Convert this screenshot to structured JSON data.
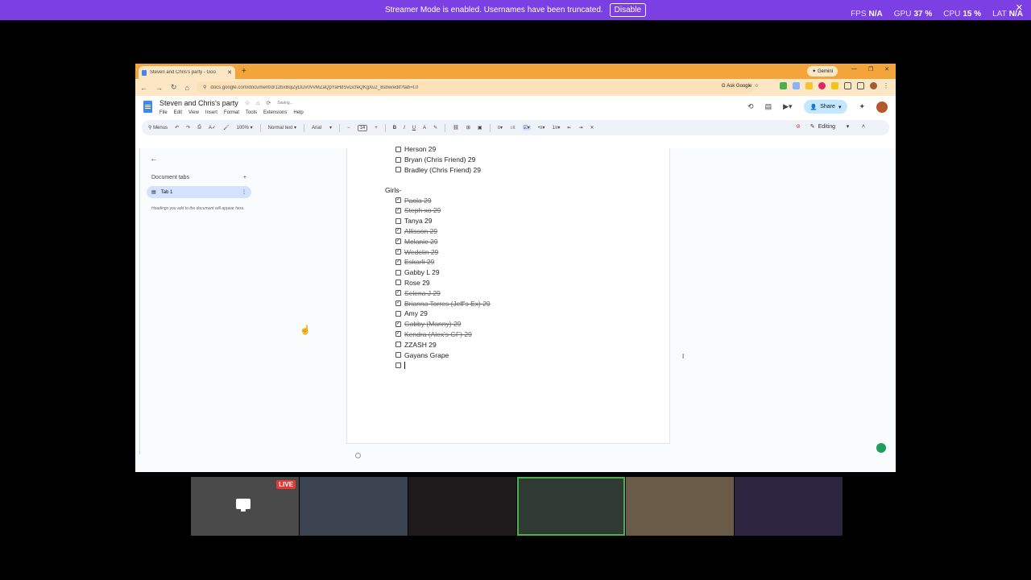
{
  "streamer": {
    "message": "Streamer Mode is enabled. Usernames have been truncated.",
    "disable_label": "Disable",
    "stats": [
      {
        "label": "FPS",
        "value": "N/A"
      },
      {
        "label": "GPU",
        "value": "37 %"
      },
      {
        "label": "CPU",
        "value": "15 %"
      },
      {
        "label": "LAT",
        "value": "N/A"
      }
    ]
  },
  "browser": {
    "tab_title": "Steven and Chris's party - Goo",
    "gemini_label": "Gemini",
    "url": "docs.google.com/document/d/12bxBqiZyDDv0VvMZaQpYaHdSvGcfeQKgXu2_8sbw/edit?tab=t.0",
    "ask_google": "Ask Google"
  },
  "docs": {
    "title": "Steven and Chris's party",
    "saving": "Saving...",
    "menus": [
      "File",
      "Edit",
      "View",
      "Insert",
      "Format",
      "Tools",
      "Extensions",
      "Help"
    ],
    "share_label": "Share",
    "toolbar": {
      "menus_label": "Menus",
      "zoom": "100%",
      "style": "Normal text",
      "font": "Arial",
      "font_size": "14",
      "mode": "Editing"
    },
    "sidebar": {
      "tabs_heading": "Document tabs",
      "add": "+",
      "tab1": "Tab 1",
      "hint": "Headings you add to the document will appear here."
    },
    "boys_tail": [
      {
        "text": "Herson 29",
        "done": false
      },
      {
        "text": "Bryan (Chris Friend) 29",
        "done": false
      },
      {
        "text": "Bradley (Chris Friend) 29",
        "done": false
      }
    ],
    "girls_heading": "Girls-",
    "girls": [
      {
        "text": "Paola 29",
        "done": true
      },
      {
        "text": "Steph xo 29",
        "done": true
      },
      {
        "text": "Tanya 29",
        "done": false
      },
      {
        "text": "Allisson 29",
        "done": true
      },
      {
        "text": "Melanie 29",
        "done": true
      },
      {
        "text": "Wedelin 29",
        "done": true
      },
      {
        "text": "Eskarli 29",
        "done": true
      },
      {
        "text": "Gabby L 29",
        "done": false
      },
      {
        "text": "Rose 29",
        "done": false
      },
      {
        "text": "Selena J 29",
        "done": true
      },
      {
        "text": "Brianna Torres (Jeff's Ex) 29",
        "done": true
      },
      {
        "text": "Amy 29",
        "done": false
      },
      {
        "text": "Gabby (Manny) 29",
        "done": true
      },
      {
        "text": "Kendra (Alex's GF) 29",
        "done": true
      },
      {
        "text": "ZZASH 29",
        "done": false
      },
      {
        "text": "Gayans Grape",
        "done": false
      }
    ]
  },
  "cams": {
    "live_label": "LIVE",
    "colors": [
      "#4a4a4a",
      "#3b4250",
      "#1c1a1a",
      "#2f3a33",
      "#6a5a48",
      "#2b2540"
    ]
  }
}
